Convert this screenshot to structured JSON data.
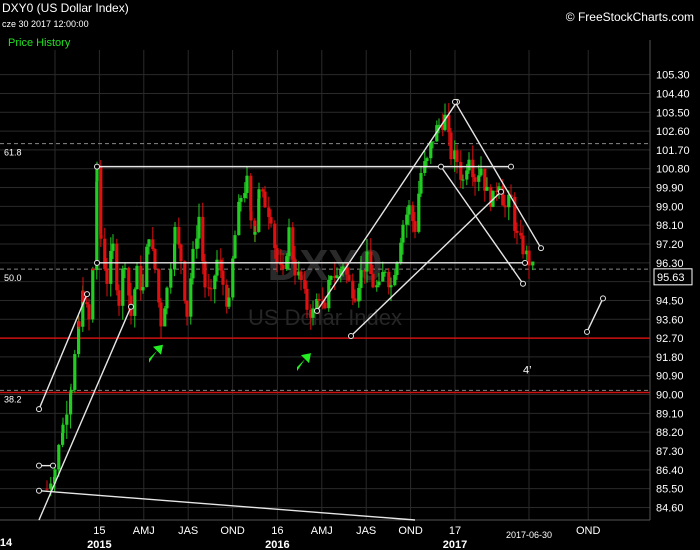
{
  "header": {
    "symbol": "DXY0 (US Dollar Index)",
    "date": "cze 30 2017 12:00:00",
    "series_label": "Price History",
    "site": "© FreeStockCharts.com"
  },
  "watermark": {
    "symbol": "DXY0",
    "name": "US Dollar Index"
  },
  "colors": {
    "up": "#22cc22",
    "down": "#dd1111",
    "grid": "#2a2a2a",
    "support": "#cc1111",
    "fib": "#888888",
    "trend": "#e6e6e6",
    "arrow": "#22ee22"
  },
  "chart_data": {
    "type": "candlestick",
    "ylim": [
      84.0,
      106.0
    ],
    "y_ticks": [
      105.3,
      104.4,
      103.5,
      102.6,
      101.7,
      100.8,
      99.9,
      99.0,
      98.1,
      97.2,
      96.3,
      95.4,
      94.5,
      93.6,
      92.7,
      91.8,
      90.9,
      90.0,
      89.1,
      88.2,
      87.3,
      86.4,
      85.5,
      84.6
    ],
    "y_tick_labels": [
      "105.30",
      "104.40",
      "103.50",
      "102.60",
      "101.70",
      "100.80",
      "99.90",
      "99.00",
      "98.10",
      "97.20",
      "96.30",
      "",
      "94.50",
      "93.60",
      "92.70",
      "91.80",
      "90.90",
      "90.00",
      "89.10",
      "88.20",
      "87.30",
      "86.40",
      "85.50",
      "84.60"
    ],
    "last_price": 95.63,
    "last_price_label": "95.63",
    "x_ticks": [
      {
        "label": "14",
        "t": 0
      },
      {
        "label": "15",
        "t": 0.111
      },
      {
        "label": "AMJ",
        "t": 0.222
      },
      {
        "label": "JAS",
        "t": 0.333
      },
      {
        "label": "OND",
        "t": 0.444
      },
      {
        "label": "16",
        "t": 0.556
      },
      {
        "label": "AMJ",
        "t": 0.667
      },
      {
        "label": "JAS",
        "t": 0.778
      },
      {
        "label": "OND",
        "t": 0.889
      },
      {
        "label": "17",
        "t": 1.0
      },
      {
        "label": "2017-06-30",
        "t": 1.185
      },
      {
        "label": "OND",
        "t": 1.333
      }
    ],
    "x_years": [
      {
        "label": "2014",
        "text": "14",
        "t": -0.03
      },
      {
        "label": "2015",
        "text": "2015",
        "t": 0.111
      },
      {
        "label": "2016",
        "text": "2016",
        "t": 0.556
      },
      {
        "label": "2017",
        "text": "2017",
        "t": 1.0
      }
    ],
    "horizontal_levels": [
      {
        "kind": "fib",
        "label": "61.8",
        "value": 102.0
      },
      {
        "kind": "fib",
        "label": "50.0",
        "value": 96.0
      },
      {
        "kind": "fib",
        "label": "38.2",
        "value": 90.2
      },
      {
        "kind": "support",
        "label": "",
        "value": 92.7
      },
      {
        "kind": "support",
        "label": "",
        "value": 90.1
      }
    ],
    "weekly_close_path": [
      [
        -0.02,
        85.5
      ],
      [
        0.0,
        86.5
      ],
      [
        0.02,
        88.5
      ],
      [
        0.04,
        90.5
      ],
      [
        0.06,
        93.2
      ],
      [
        0.07,
        94.8
      ],
      [
        0.085,
        93.5
      ],
      [
        0.095,
        96.0
      ],
      [
        0.105,
        100.5
      ],
      [
        0.115,
        97.5
      ],
      [
        0.13,
        95.5
      ],
      [
        0.145,
        97.0
      ],
      [
        0.16,
        94.5
      ],
      [
        0.175,
        96.5
      ],
      [
        0.19,
        93.8
      ],
      [
        0.205,
        95.8
      ],
      [
        0.22,
        95.0
      ],
      [
        0.235,
        97.8
      ],
      [
        0.25,
        96.0
      ],
      [
        0.265,
        93.5
      ],
      [
        0.28,
        95.0
      ],
      [
        0.3,
        97.8
      ],
      [
        0.315,
        96.5
      ],
      [
        0.33,
        93.9
      ],
      [
        0.345,
        96.6
      ],
      [
        0.36,
        98.5
      ],
      [
        0.375,
        95.2
      ],
      [
        0.39,
        94.6
      ],
      [
        0.405,
        96.4
      ],
      [
        0.42,
        95.3
      ],
      [
        0.435,
        94.2
      ],
      [
        0.45,
        97.6
      ],
      [
        0.465,
        99.5
      ],
      [
        0.48,
        100.1
      ],
      [
        0.49,
        98.4
      ],
      [
        0.5,
        98.0
      ],
      [
        0.51,
        99.6
      ],
      [
        0.525,
        99.2
      ],
      [
        0.54,
        98.6
      ],
      [
        0.555,
        96.3
      ],
      [
        0.57,
        95.6
      ],
      [
        0.585,
        97.8
      ],
      [
        0.6,
        96.0
      ],
      [
        0.615,
        95.4
      ],
      [
        0.63,
        94.2
      ],
      [
        0.645,
        93.9
      ],
      [
        0.66,
        94.8
      ],
      [
        0.675,
        93.8
      ],
      [
        0.69,
        95.9
      ],
      [
        0.705,
        95.6
      ],
      [
        0.72,
        96.3
      ],
      [
        0.735,
        95.3
      ],
      [
        0.75,
        94.9
      ],
      [
        0.765,
        95.8
      ],
      [
        0.78,
        96.4
      ],
      [
        0.795,
        95.3
      ],
      [
        0.81,
        95.0
      ],
      [
        0.825,
        96.1
      ],
      [
        0.84,
        95.2
      ],
      [
        0.855,
        96.6
      ],
      [
        0.87,
        98.2
      ],
      [
        0.885,
        98.9
      ],
      [
        0.9,
        98.0
      ],
      [
        0.915,
        100.6
      ],
      [
        0.93,
        101.1
      ],
      [
        0.945,
        102.3
      ],
      [
        0.96,
        102.9
      ],
      [
        0.975,
        103.2
      ],
      [
        0.99,
        101.5
      ],
      [
        1.005,
        101.2
      ],
      [
        1.02,
        100.2
      ],
      [
        1.035,
        101.6
      ],
      [
        1.05,
        100.4
      ],
      [
        1.065,
        100.9
      ],
      [
        1.08,
        99.6
      ],
      [
        1.095,
        99.3
      ],
      [
        1.11,
        100.3
      ],
      [
        1.125,
        98.9
      ],
      [
        1.14,
        99.3
      ],
      [
        1.155,
        97.5
      ],
      [
        1.17,
        97.0
      ],
      [
        1.185,
        96.4
      ],
      [
        1.2,
        95.7
      ]
    ],
    "trend_lines": [
      {
        "from": [
          0.105,
          100.9
        ],
        "to": [
          1.14,
          100.9
        ]
      },
      {
        "from": [
          0.105,
          96.3
        ],
        "to": [
          1.175,
          96.3
        ]
      },
      {
        "from": [
          0.655,
          94.0
        ],
        "to": [
          1.005,
          104.0
        ]
      },
      {
        "from": [
          0.74,
          92.8
        ],
        "to": [
          1.115,
          99.7
        ]
      },
      {
        "from": [
          1.0,
          104.0
        ],
        "to": [
          1.215,
          97.0
        ]
      },
      {
        "from": [
          0.965,
          100.9
        ],
        "to": [
          1.17,
          95.3
        ]
      },
      {
        "from": [
          -0.04,
          89.3
        ],
        "to": [
          0.08,
          94.8
        ]
      },
      {
        "from": [
          -0.04,
          84.0
        ],
        "to": [
          0.19,
          94.2
        ]
      },
      {
        "from": [
          -0.04,
          85.4
        ],
        "to": [
          0.9,
          84.0
        ]
      },
      {
        "from": [
          1.33,
          93.0
        ],
        "to": [
          1.37,
          94.6
        ]
      },
      {
        "from": [
          -0.04,
          86.6
        ],
        "to": [
          -0.005,
          86.6
        ]
      }
    ],
    "up_arrows": [
      [
        0.25,
        92.0
      ],
      [
        0.62,
        91.6
      ]
    ],
    "annotation": {
      "text": "4’",
      "x": 1.17,
      "y": 91.0
    }
  }
}
